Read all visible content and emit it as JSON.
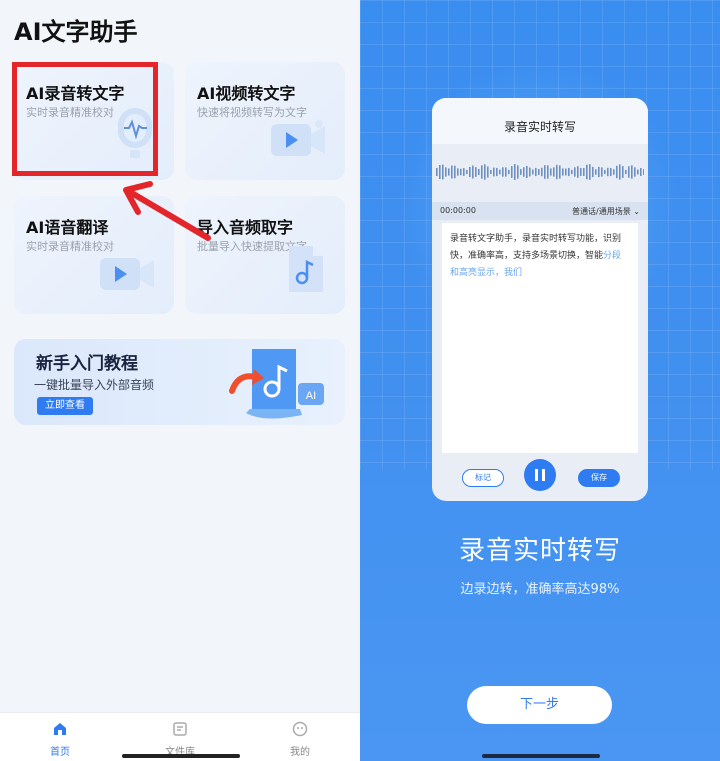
{
  "app_title": "AI文字助手",
  "cards": [
    {
      "title": "AI录音转文字",
      "subtitle": "实时录音精准校对"
    },
    {
      "title": "AI视频转文字",
      "subtitle": "快速将视频转写为文字"
    },
    {
      "title": "AI语音翻译",
      "subtitle": "实时录音精准校对"
    },
    {
      "title": "导入音频取字",
      "subtitle": "批量导入快速提取文字"
    }
  ],
  "banner": {
    "title": "新手入门教程",
    "subtitle": "一键批量导入外部音频",
    "button": "立即查看",
    "badge": "AI"
  },
  "tabbar": [
    {
      "label": "首页",
      "icon": "home-icon",
      "active": true
    },
    {
      "label": "文件库",
      "icon": "file-icon",
      "active": false
    },
    {
      "label": "我的",
      "icon": "profile-icon",
      "active": false
    }
  ],
  "phone": {
    "title": "录音实时转写",
    "time": "00:00:00",
    "mode": "普通话/通用场景",
    "text": "录音转文字助手，录音实时转写功能，识别快，准确率高，支持多场景切换，智能",
    "text_highlight": "分段和高亮显示，我们",
    "mark_label": "标记",
    "save_label": "保存"
  },
  "promo": {
    "title": "录音实时转写",
    "subtitle": "边录边转，准确率高达98%"
  },
  "next_label": "下一步",
  "colors": {
    "accent": "#2f7cf2",
    "highlight": "#e3262a",
    "panel_bg": "#3f8ff0"
  }
}
